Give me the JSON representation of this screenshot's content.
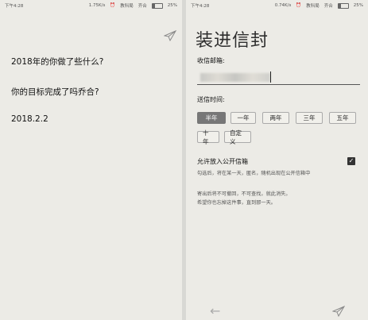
{
  "left": {
    "status": {
      "time": "下午4:28",
      "speed": "1.75K/s",
      "carrier": "教科局",
      "signal": "齐合",
      "battery": "25%"
    },
    "questions": [
      "2018年的你做了些什么?",
      "你的目标完成了吗乔合?",
      "2018.2.2"
    ]
  },
  "right": {
    "status": {
      "time": "下午4:28",
      "speed": "0.74K/s",
      "carrier": "教科局",
      "signal": "齐合",
      "battery": "25%"
    },
    "title": "装进信封",
    "email_label": "收信邮箱:",
    "time_label": "送信时间:",
    "options_row1": [
      "半年",
      "一年",
      "两年",
      "三年",
      "五年"
    ],
    "options_row2": [
      "十年",
      "自定义"
    ],
    "selected_option": "半年",
    "public_label": "允许放入公开信箱",
    "public_checked": true,
    "public_note": "勾选后，将在某一天，匿名，随机出现在公开信箱中",
    "warning1": "寄出后将不可撤回，不可查找，就此消失。",
    "warning2": "希望你也忘掉这件事，直到那一天。"
  }
}
